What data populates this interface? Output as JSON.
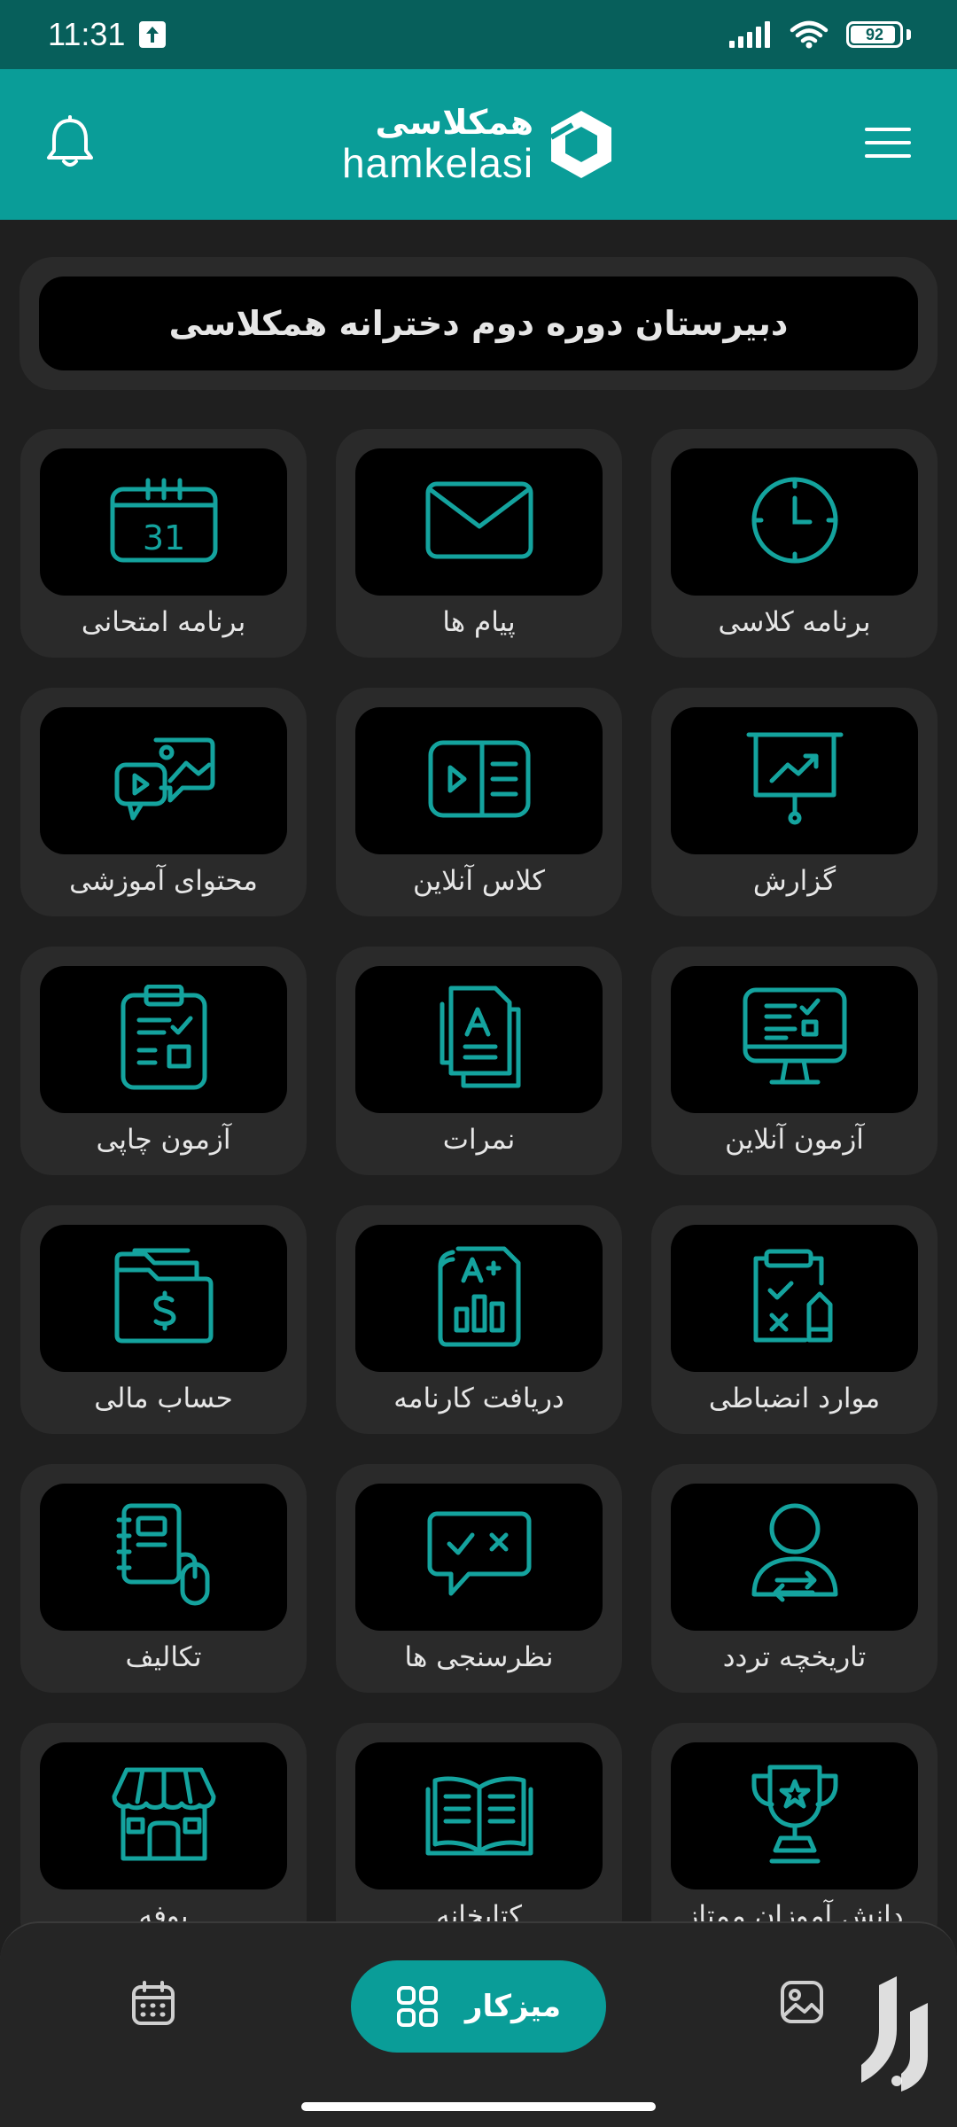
{
  "status_bar": {
    "time": "11:31",
    "battery_level": "92",
    "battery_fraction": 0.92
  },
  "header": {
    "logo_fa": "همکلاسی",
    "logo_en": "hamkelasi",
    "accent_color": "#0a9d98"
  },
  "school": {
    "name": "دبیرستان دوره دوم دخترانه همکلاسی"
  },
  "tiles": [
    {
      "label": "برنامه کلاسی",
      "icon": "clock-icon"
    },
    {
      "label": "پیام ها",
      "icon": "envelope-icon"
    },
    {
      "label": "برنامه امتحانی",
      "icon": "calendar-31-icon"
    },
    {
      "label": "گزارش",
      "icon": "presentation-chart-icon"
    },
    {
      "label": "کلاس آنلاین",
      "icon": "video-lesson-icon"
    },
    {
      "label": "محتوای آموزشی",
      "icon": "media-content-icon"
    },
    {
      "label": "آزمون آنلاین",
      "icon": "monitor-checklist-icon"
    },
    {
      "label": "نمرات",
      "icon": "grade-document-icon"
    },
    {
      "label": "آزمون چاپی",
      "icon": "clipboard-checklist-icon"
    },
    {
      "label": "موارد انضباطی",
      "icon": "clipboard-pencil-icon"
    },
    {
      "label": "دریافت کارنامه",
      "icon": "report-card-icon"
    },
    {
      "label": "حساب مالی",
      "icon": "folder-dollar-icon"
    },
    {
      "label": "تاریخچه تردد",
      "icon": "user-transfer-icon"
    },
    {
      "label": "نظرسنجی ها",
      "icon": "survey-bubble-icon"
    },
    {
      "label": "تکالیف",
      "icon": "notebook-mouse-icon"
    },
    {
      "label": "دانش آموزان ممتاز",
      "icon": "trophy-icon"
    },
    {
      "label": "کتابخانه",
      "icon": "open-book-icon"
    },
    {
      "label": "بوفه",
      "icon": "store-icon"
    }
  ],
  "bottom_nav": {
    "desk_label": "میزکار"
  }
}
